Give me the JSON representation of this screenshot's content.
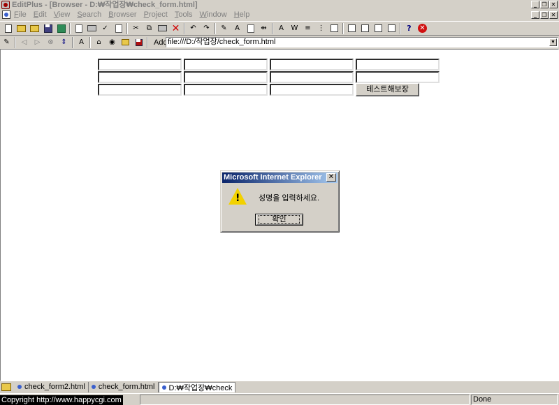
{
  "window": {
    "title": "EditPlus - [Browser - D:₩작업장₩check_form.html]"
  },
  "menu": {
    "items": [
      "File",
      "Edit",
      "View",
      "Search",
      "Browser",
      "Project",
      "Tools",
      "Window",
      "Help"
    ]
  },
  "address": {
    "label": "Address",
    "value": "file:///D:/작업장/check_form.html"
  },
  "form": {
    "button_label": "테스트해보장"
  },
  "dialog": {
    "title": "Microsoft Internet Explorer",
    "message": "성명을 입력하세요.",
    "ok_label": "확인"
  },
  "tabs": [
    {
      "label": "check_form2.html",
      "active": false
    },
    {
      "label": "check_form.html",
      "active": false
    },
    {
      "label": "D:₩작업장₩check",
      "active": true
    }
  ],
  "status": {
    "copyright": "Copyright   http://www.happycgi.com",
    "state": "Done"
  }
}
